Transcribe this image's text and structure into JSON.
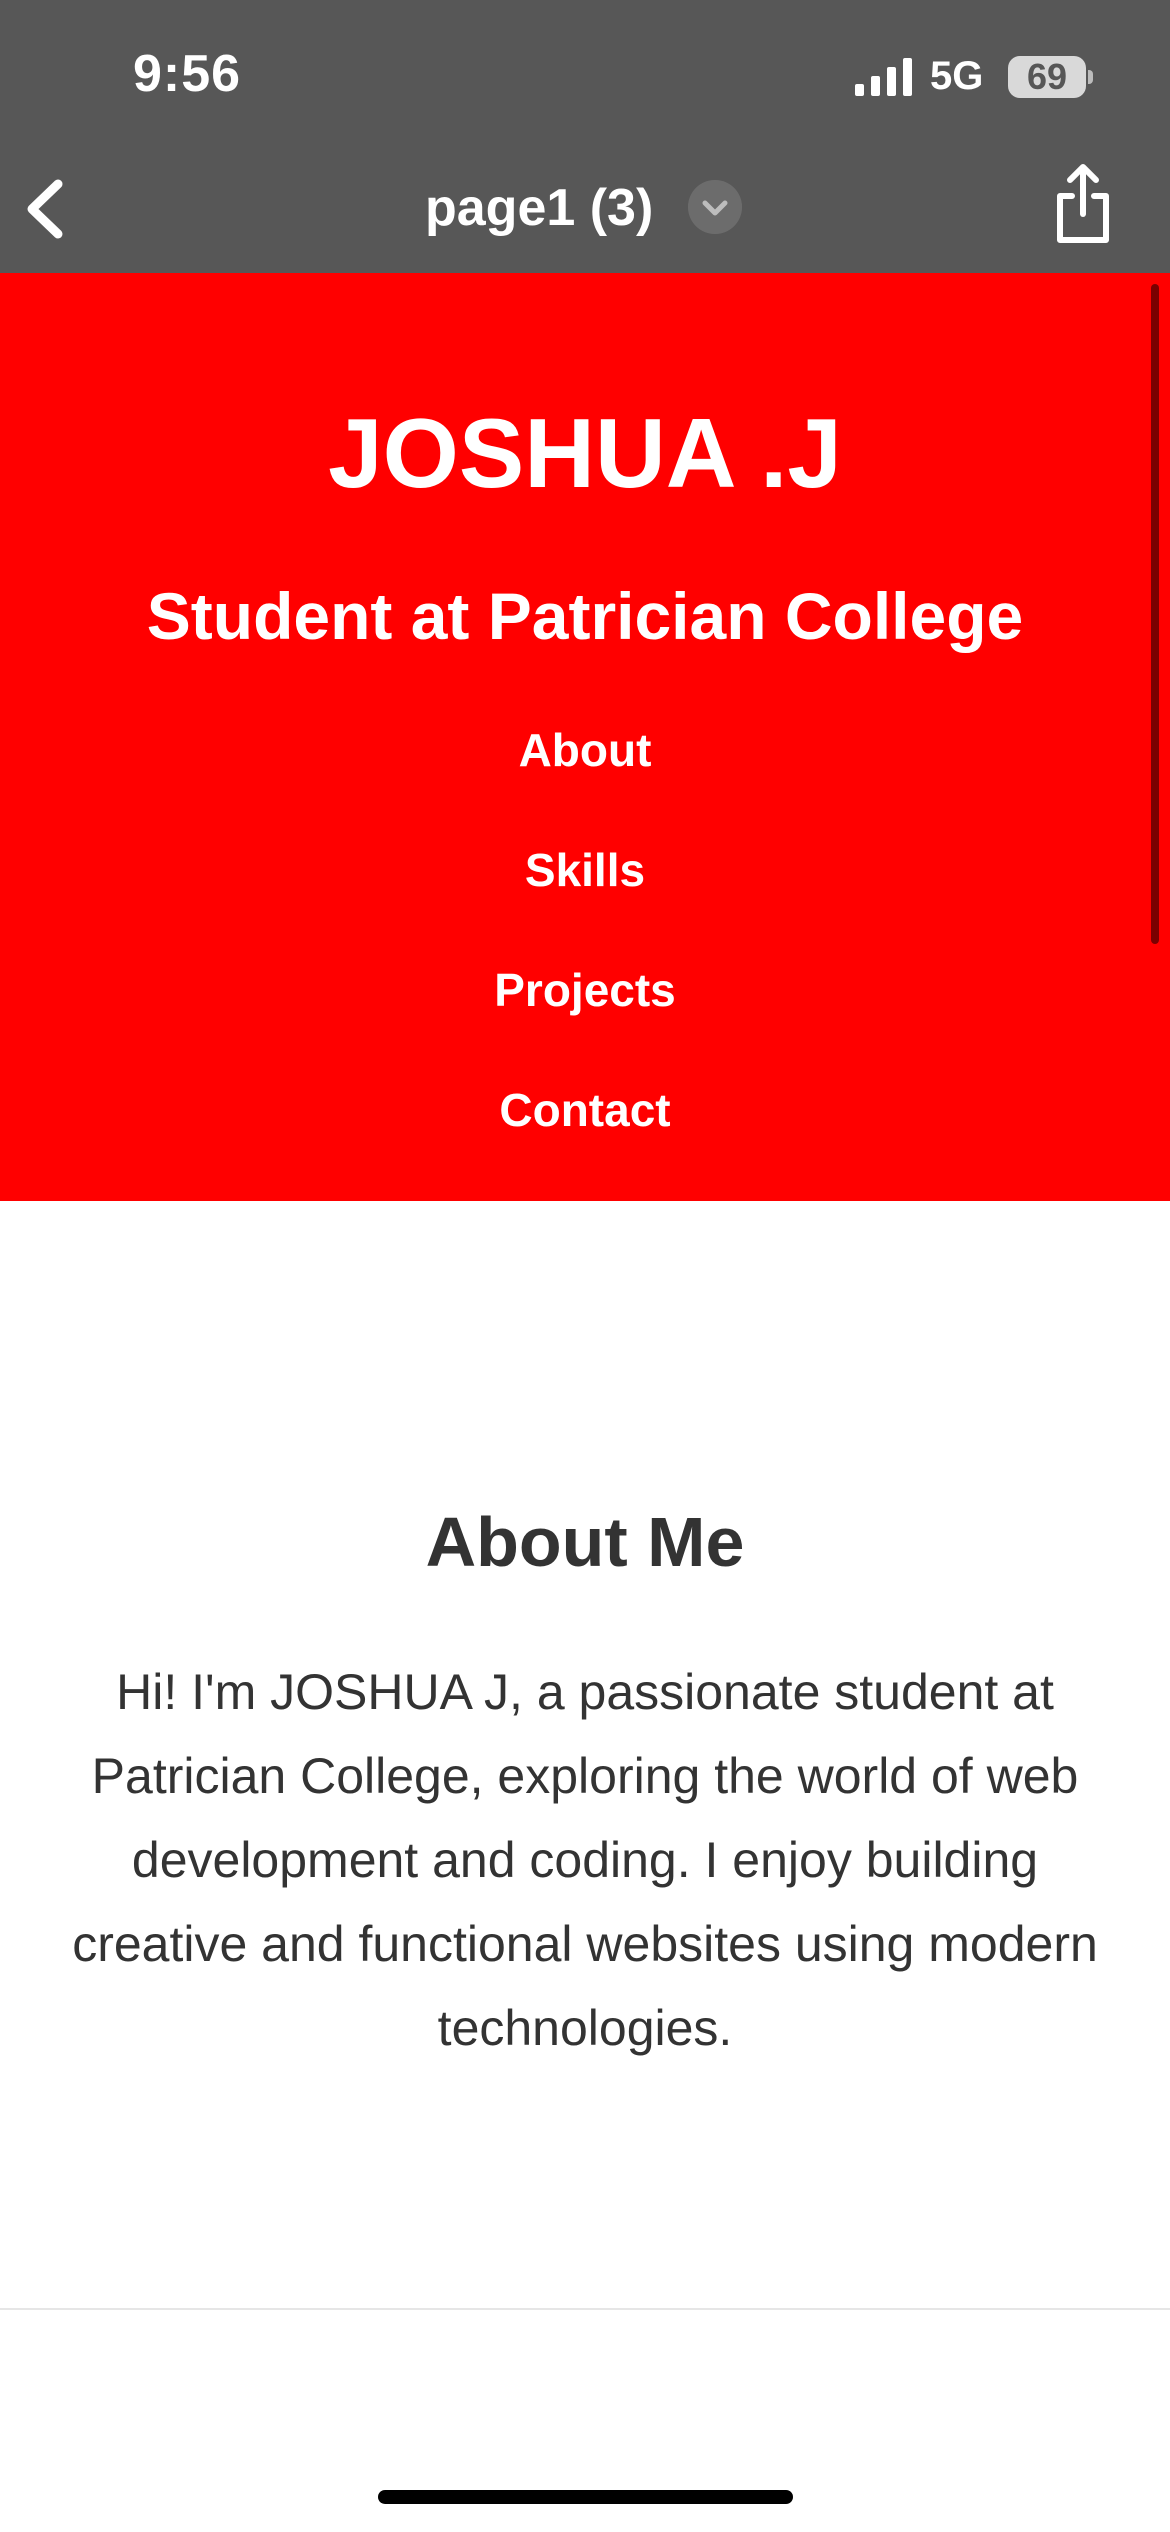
{
  "status_bar": {
    "time": "9:56",
    "network": "5G",
    "battery": "69"
  },
  "nav_bar": {
    "title": "page1 (3)"
  },
  "hero": {
    "name": "JOSHUA .J",
    "subtitle": "Student at Patrician College",
    "background_color": "#ff0000",
    "links": [
      "About",
      "Skills",
      "Projects",
      "Contact"
    ]
  },
  "about": {
    "heading": "About Me",
    "body": "Hi! I'm JOSHUA J, a passionate student at Patrician College, exploring the world of web development and coding. I enjoy building creative and functional websites using modern technologies."
  },
  "icons": {
    "back": "chevron-left-icon",
    "title_menu": "chevron-down-icon",
    "share": "share-icon",
    "signal": "signal-icon"
  }
}
